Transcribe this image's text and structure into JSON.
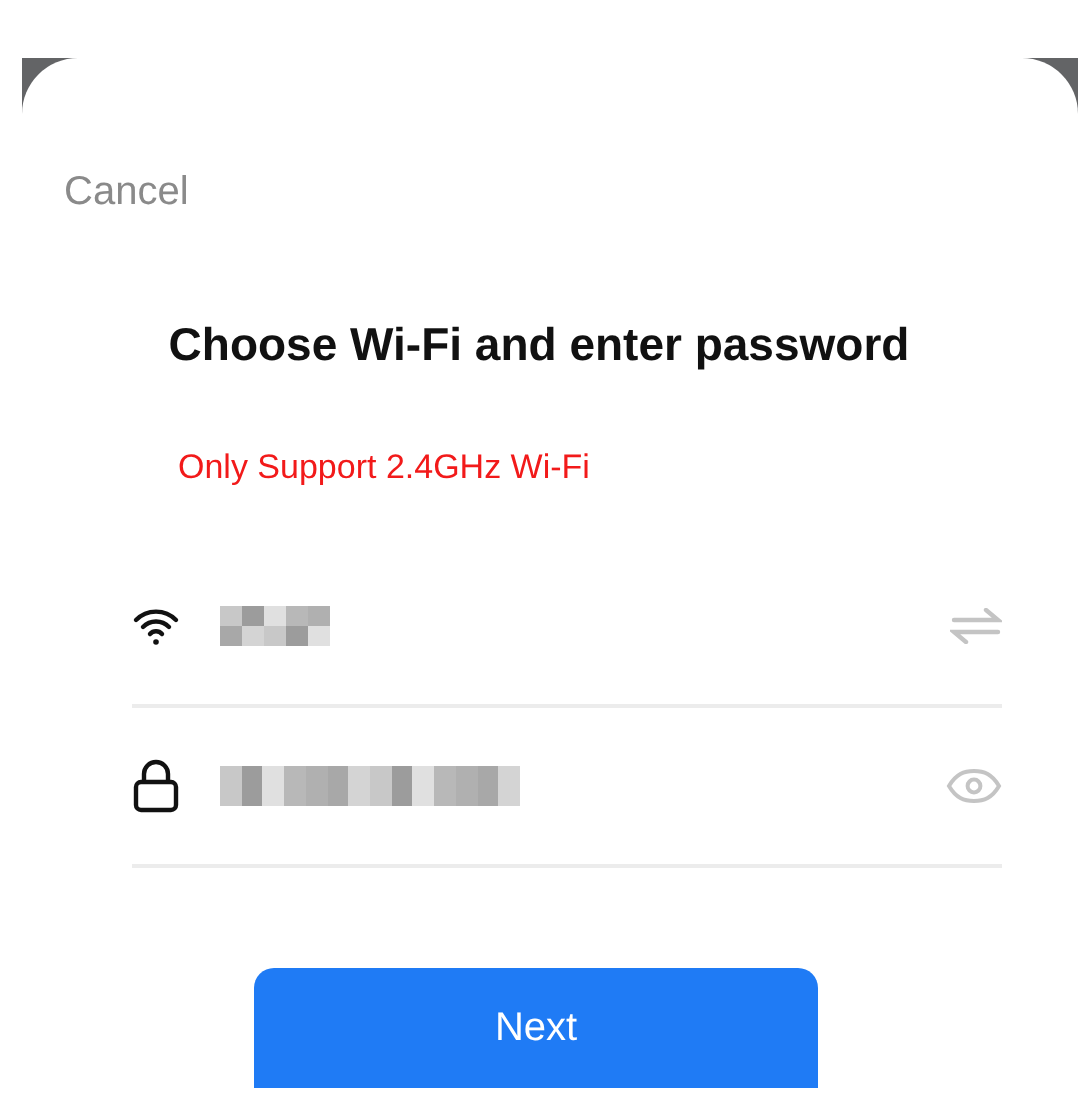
{
  "cancel": "Cancel",
  "title": "Choose Wi-Fi and enter password",
  "notice": "Only Support 2.4GHz Wi-Fi",
  "fields": [
    {
      "kind": "network"
    },
    {
      "kind": "password"
    }
  ],
  "next_button": "Next"
}
